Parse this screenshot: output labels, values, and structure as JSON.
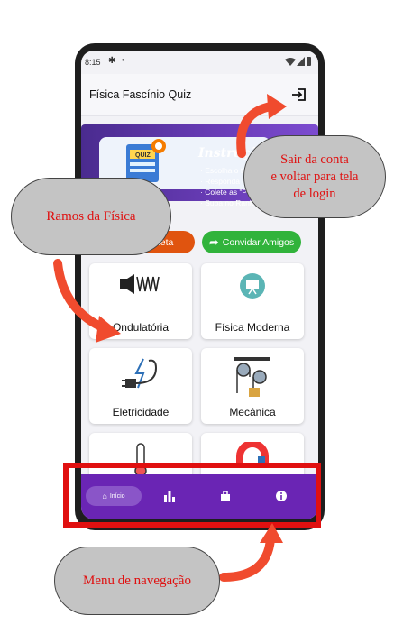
{
  "status_bar": {
    "time": "8:15"
  },
  "app": {
    "title": "Física Fascínio Quiz"
  },
  "banner": {
    "title": "Instruçõ",
    "quiz_label": "QUIZ",
    "lines": [
      "· Escolha o ter",
      "· Responda o",
      "· Colete as \"Phy",
      "· Suba no Ranking"
    ]
  },
  "buttons": {
    "collect": "Coleta",
    "invite": "Convidar Amigos"
  },
  "cards": [
    {
      "label": "Ondulatória"
    },
    {
      "label": "Física Moderna"
    },
    {
      "label": "Eletricidade"
    },
    {
      "label": "Mecânica"
    }
  ],
  "nav": {
    "home_label": "Início"
  },
  "callouts": {
    "branches": "Ramos da Física",
    "logout": [
      "Sair da conta",
      "e voltar para tela",
      "de login"
    ],
    "navigation": "Menu de navegação"
  },
  "colors": {
    "accent_purple": "#6a25b4",
    "callout_red": "#e01010",
    "orange": "#e0540f",
    "green": "#31b33b"
  }
}
